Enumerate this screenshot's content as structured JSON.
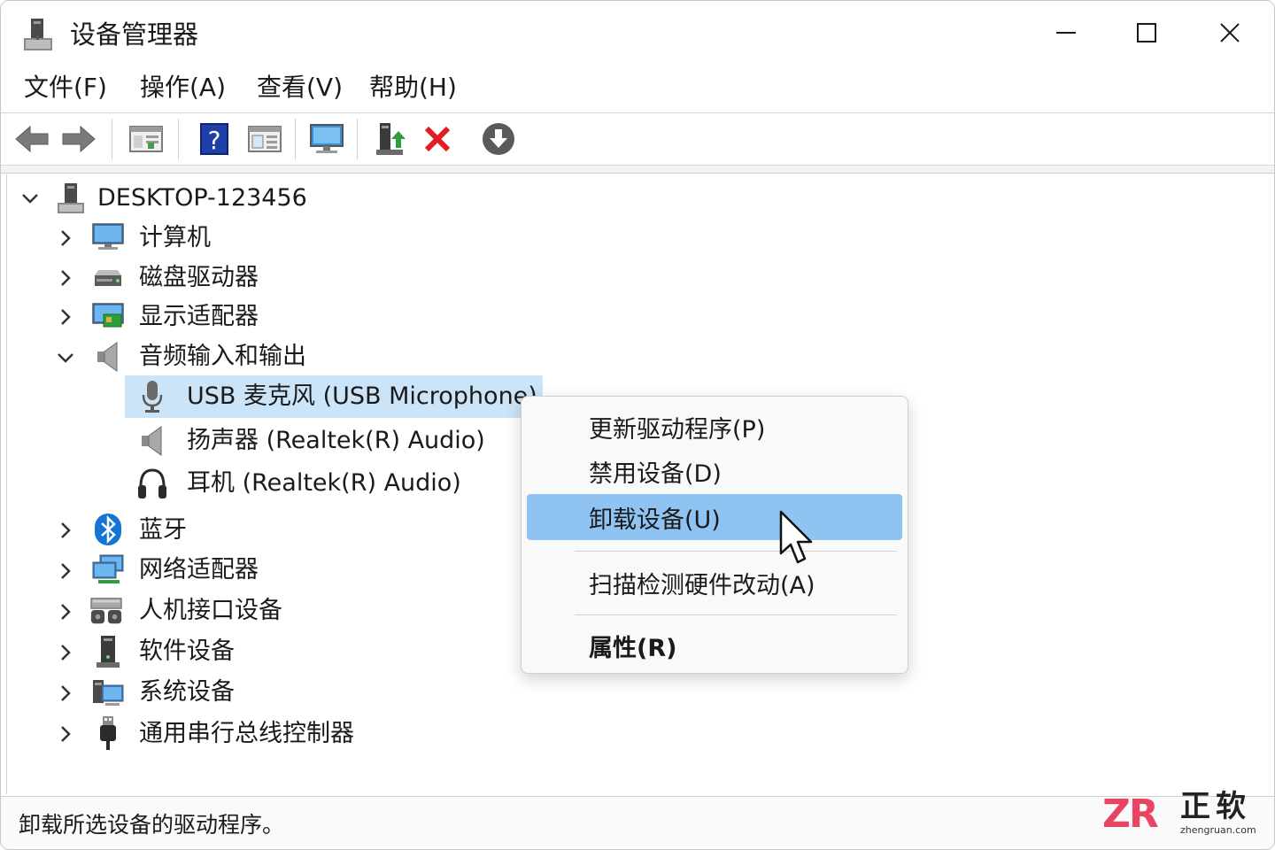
{
  "window": {
    "title": "设备管理器",
    "icons": {
      "app": "device-manager-icon",
      "minimize": "minimize-icon",
      "maximize": "maximize-icon",
      "close": "close-icon"
    }
  },
  "menubar": {
    "items": [
      {
        "label": "文件(F)"
      },
      {
        "label": "操作(A)"
      },
      {
        "label": "查看(V)"
      },
      {
        "label": "帮助(H)"
      }
    ]
  },
  "toolbar": {
    "buttons": [
      {
        "icon": "back-arrow-icon"
      },
      {
        "icon": "forward-arrow-icon"
      },
      {
        "icon": "show-hide-console-tree-icon"
      },
      {
        "icon": "help-icon"
      },
      {
        "icon": "properties-pane-icon"
      },
      {
        "icon": "computer-monitor-icon"
      },
      {
        "icon": "update-driver-icon"
      },
      {
        "icon": "uninstall-device-icon"
      },
      {
        "icon": "download-circle-icon"
      }
    ]
  },
  "tree": {
    "root": {
      "label": "DESKTOP-123456",
      "expanded": true,
      "icon": "computer-tower-icon"
    },
    "categories": [
      {
        "label": "计算机",
        "expanded": false,
        "icon": "monitor-icon"
      },
      {
        "label": "磁盘驱动器",
        "expanded": false,
        "icon": "disk-drive-icon"
      },
      {
        "label": "显示适配器",
        "expanded": false,
        "icon": "display-adapter-icon"
      },
      {
        "label": "音频输入和输出",
        "expanded": true,
        "icon": "speaker-icon",
        "children": [
          {
            "label": "USB 麦克风 (USB Microphone)",
            "icon": "microphone-icon",
            "selected": true
          },
          {
            "label": "扬声器 (Realtek(R) Audio)",
            "icon": "speaker-icon"
          },
          {
            "label": "耳机 (Realtek(R) Audio)",
            "icon": "headphones-icon"
          }
        ]
      },
      {
        "label": "蓝牙",
        "expanded": false,
        "icon": "bluetooth-icon"
      },
      {
        "label": "网络适配器",
        "expanded": false,
        "icon": "network-adapter-icon"
      },
      {
        "label": "人机接口设备",
        "expanded": false,
        "icon": "hid-icon"
      },
      {
        "label": "软件设备",
        "expanded": false,
        "icon": "software-device-icon"
      },
      {
        "label": "系统设备",
        "expanded": false,
        "icon": "system-device-icon"
      },
      {
        "label": "通用串行总线控制器",
        "expanded": false,
        "icon": "usb-icon"
      }
    ]
  },
  "context_menu": {
    "items": [
      {
        "label": "更新驱动程序(P)"
      },
      {
        "label": "禁用设备(D)"
      },
      {
        "label": "卸载设备(U)",
        "highlighted": true
      },
      {
        "label": "扫描检测硬件改动(A)"
      },
      {
        "label": "属性(R)",
        "bold": true
      }
    ]
  },
  "statusbar": {
    "text": "卸载所选设备的驱动程序。"
  },
  "watermark": {
    "logo": "ZR",
    "cn": "正软",
    "en": "zhengruan.com"
  },
  "colors": {
    "selection": "#cce4f7",
    "menu_highlight": "#8ec3f2",
    "delete_red": "#e31b23",
    "watermark_red": "#e84463"
  }
}
